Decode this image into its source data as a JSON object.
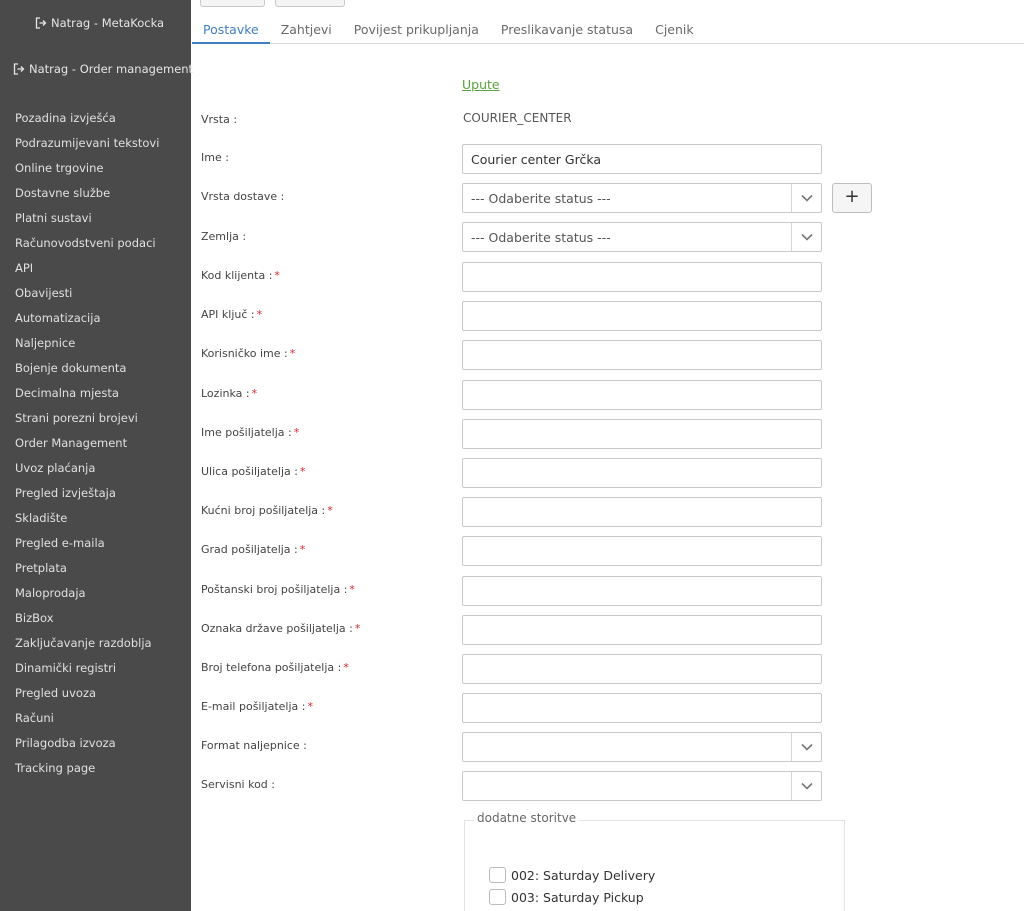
{
  "sidebar": {
    "back_links": [
      "Natrag - MetaKocka",
      "Natrag - Order management"
    ],
    "items": [
      "Pozadina izvješća",
      "Podrazumijevani tekstovi",
      "Online trgovine",
      "Dostavne službe",
      "Platni sustavi",
      "Računovodstveni podaci",
      "API",
      "Obavijesti",
      "Automatizacija",
      "Naljepnice",
      "Bojenje dokumenta",
      "Decimalna mjesta",
      "Strani porezni brojevi",
      "Order Management",
      "Uvoz plaćanja",
      "Pregled izvještaja",
      "Skladište",
      "Pregled e-maila",
      "Pretplata",
      "Maloprodaja",
      "BizBox",
      "Zaključavanje razdoblja",
      "Dinamički registri",
      "Pregled uvoza",
      "Računi",
      "Prilagodba izvoza",
      "Tracking page"
    ]
  },
  "tabs": [
    "Postavke",
    "Zahtjevi",
    "Povijest prikupljanja",
    "Preslikavanje statusa",
    "Cjenik"
  ],
  "active_tab": "Postavke",
  "form": {
    "upute": "Upute",
    "vrsta_label": "Vrsta :",
    "vrsta_value": "COURIER_CENTER",
    "ime_label": "Ime :",
    "ime_value": "Courier center Grčka",
    "vrsta_dostave_label": "Vrsta dostave :",
    "vrsta_dostave_value": "--- Odaberite status ---",
    "add_button": "+",
    "zemlja_label": "Zemlja :",
    "zemlja_value": "--- Odaberite status ---",
    "required_fields": [
      "Kod klijenta :",
      "API ključ :",
      "Korisničko ime :",
      "Lozinka :",
      "Ime pošiljatelja :",
      "Ulica pošiljatelja :",
      "Kućni broj pošiljatelja :",
      "Grad pošiljatelja :",
      "Poštanski broj pošiljatelja :",
      "Oznaka države pošiljatelja :",
      "Broj telefona pošiljatelja :",
      "E-mail pošiljatelja :"
    ],
    "required_marker": "*",
    "format_label": "Format naljepnice :",
    "servisni_label": "Servisni kod :",
    "extras_legend": "dodatne storitve",
    "extras": [
      "002: Saturday Delivery",
      "003: Saturday Pickup"
    ]
  },
  "colors": {
    "sidebar_bg": "#4a4a4a",
    "active_tab": "#3f7fc4",
    "link": "#5a9e3a",
    "required": "#d9262b"
  }
}
